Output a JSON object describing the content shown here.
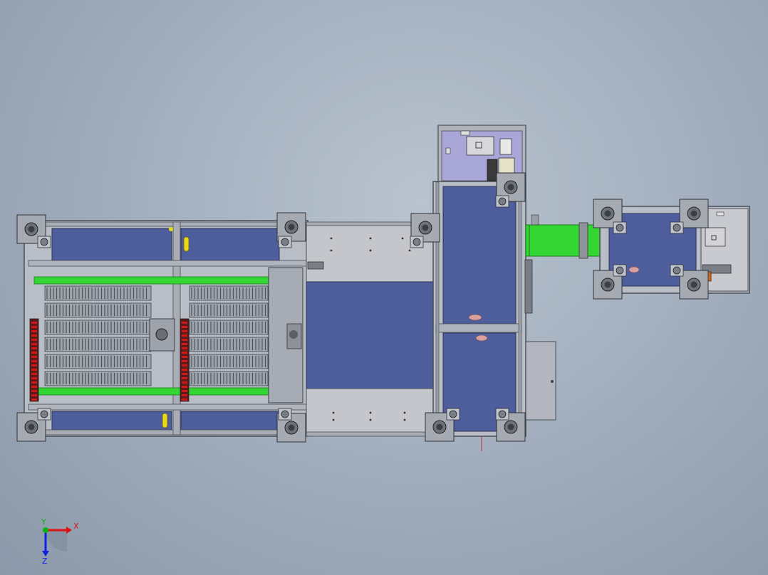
{
  "viewport": {
    "background_top": "#8f9cad",
    "background_bottom": "#c2ccd6"
  },
  "colors": {
    "frame_gray": "#b8bcc4",
    "frame_dark": "#5c6068",
    "panel_blue": "#4e5e9c",
    "panel_blue_dark": "#3f4d86",
    "belt_green": "#33d633",
    "lavender": "#a9a6d8",
    "plate_gray": "#c4c6cc",
    "accent_red": "#d01818",
    "accent_yellow": "#e8d81a",
    "accent_orange": "#d06a20",
    "accent_pink": "#d9a0a0"
  },
  "triad": {
    "x_label": "X",
    "y_label": "Y",
    "z_label": "Z",
    "x_color": "#e01010",
    "y_color": "#10b010",
    "z_color": "#1020e0"
  },
  "model": {
    "name": "conveyor-assembly-top-view"
  }
}
